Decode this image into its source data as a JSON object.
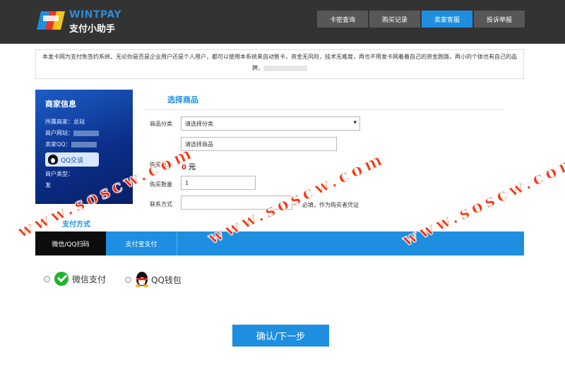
{
  "header": {
    "logo_en": "WINTPAY",
    "logo_cn": "支付小助手",
    "nav": [
      "卡密查询",
      "购买记录",
      "卖家客服",
      "投诉举报"
    ],
    "active_nav": "卖家客服"
  },
  "notice": {
    "text_line1": "本发卡网为支付免签约系统，无论你是否是企业用户还是个人用户，都可以使用本系统来自动售卡，资金无风险，技术无难度，再也不用发卡网着着自己的资金跑路，再小的个体也有自己的品",
    "text_line2": "牌，"
  },
  "merchant": {
    "title": "商家信息",
    "row1": "所属商家：总站",
    "row2": "商户网站：",
    "row3": "卖家QQ：",
    "qq_button": "QQ交谈",
    "row4": "商户类型：",
    "row5": "发"
  },
  "goods": {
    "section_title": "选择商品",
    "category_label": "商品分类",
    "category_value": "请选择分类",
    "goods_placeholder": "请选择商品",
    "total_label": "购买总价",
    "total_value": "0",
    "total_unit": "元",
    "qty_label": "购买数量",
    "qty_value": "1",
    "contact_label": "联系方式",
    "contact_hint": "必填，作为购买者凭证"
  },
  "payment": {
    "title": "支付方式",
    "tabs": [
      "微信/QQ扫码",
      "支付宝支付"
    ],
    "options": [
      "微信支付",
      "QQ钱包"
    ],
    "submit": "确认/下一步"
  },
  "watermark": "www.soscw.com",
  "colors": {
    "accent": "#1e8fe0",
    "header_bg": "#333333",
    "price": "#e31b1b",
    "watermark": "#ff2a00"
  }
}
